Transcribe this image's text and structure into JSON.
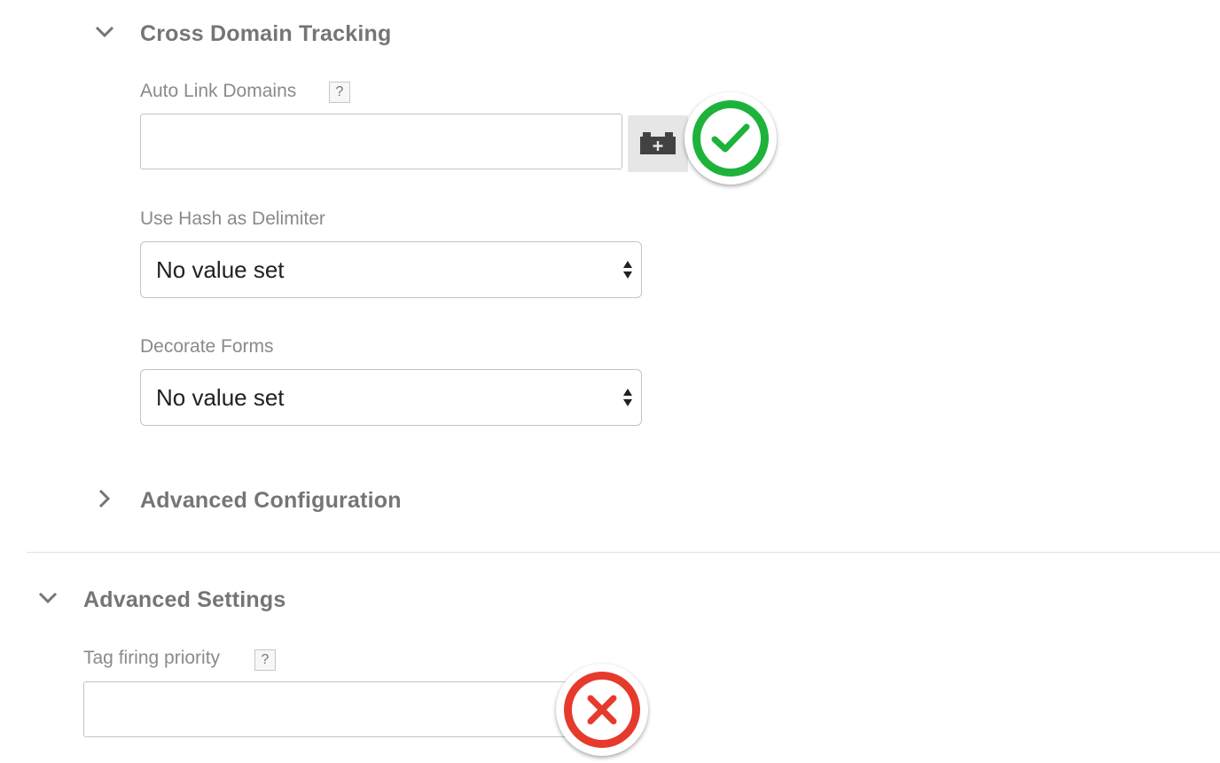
{
  "cross_domain": {
    "title": "Cross Domain Tracking",
    "icon": "chevron-down-icon",
    "auto_link": {
      "label": "Auto Link Domains",
      "help": "?",
      "value": "",
      "variable_button_icon": "add-variable-icon",
      "status_icon": "check-icon",
      "status_color": "#1db33b"
    },
    "use_hash": {
      "label": "Use Hash as Delimiter",
      "value": "No value set"
    },
    "decorate_forms": {
      "label": "Decorate Forms",
      "value": "No value set"
    }
  },
  "advanced_configuration": {
    "title": "Advanced Configuration",
    "icon": "chevron-right-icon"
  },
  "advanced_settings": {
    "title": "Advanced Settings",
    "icon": "chevron-down-icon",
    "tag_priority": {
      "label": "Tag firing priority",
      "help": "?",
      "value": "",
      "status_icon": "x-icon",
      "status_color": "#e53a2c"
    }
  }
}
